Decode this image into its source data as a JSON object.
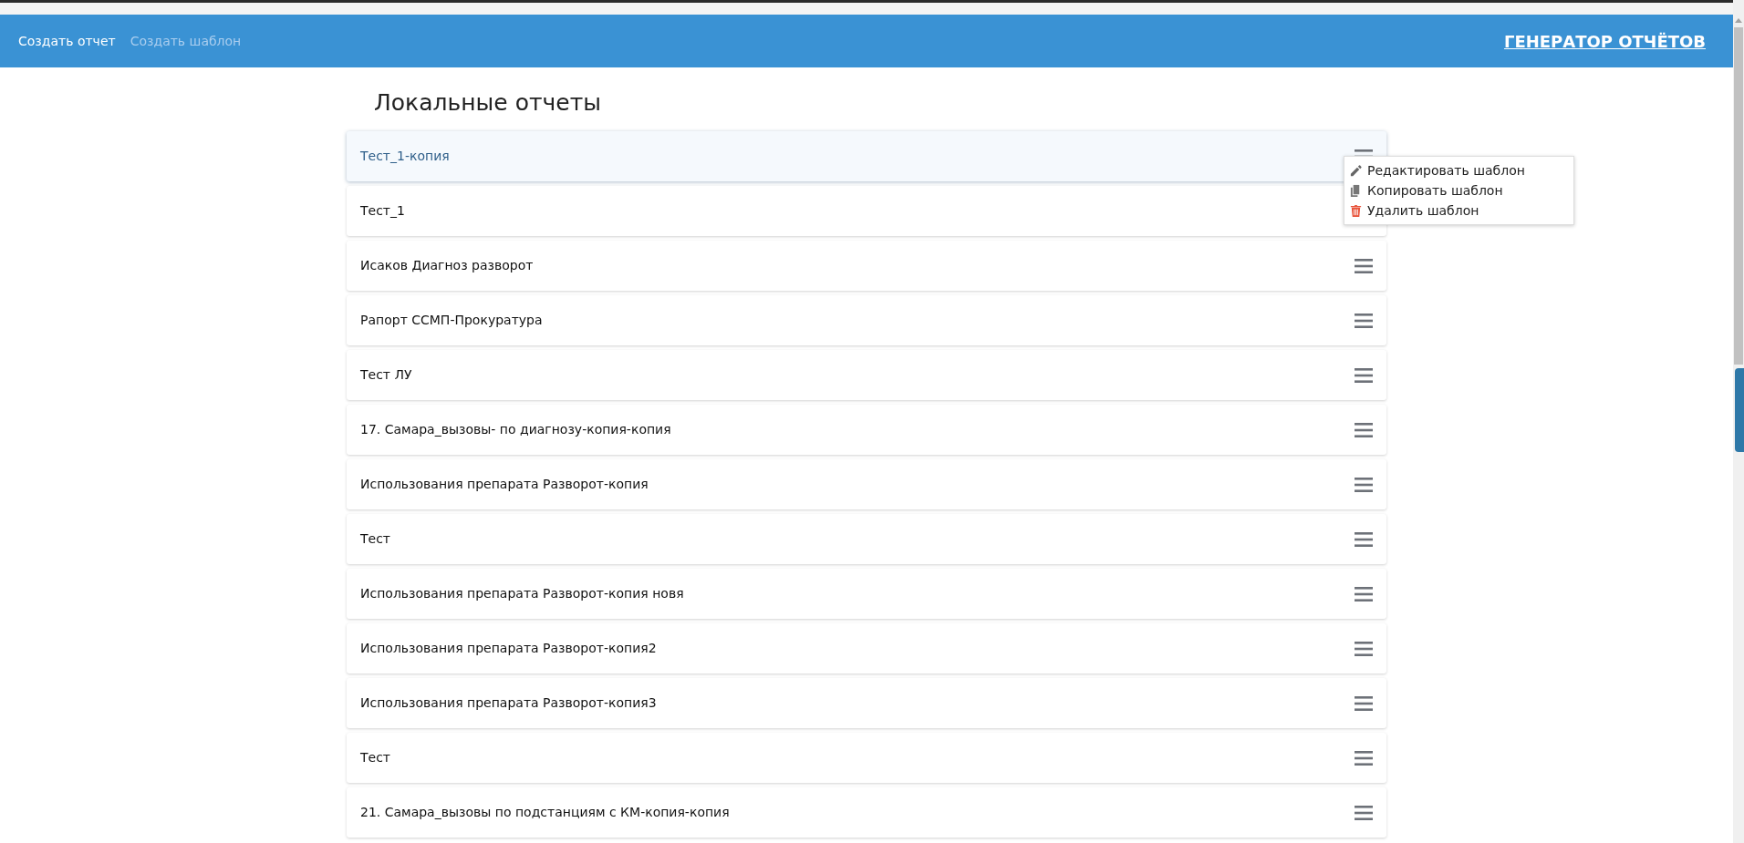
{
  "nav": {
    "links": [
      {
        "label": "Создать отчет",
        "selected": true
      },
      {
        "label": "Создать шаблон",
        "selected": false
      }
    ],
    "brand": "ГЕНЕРАТОР ОТЧЁТОВ"
  },
  "heading": "Локальные отчеты",
  "reports": [
    {
      "name": "Тест_1-копия",
      "selected": true
    },
    {
      "name": "Тест_1",
      "selected": false
    },
    {
      "name": "Исаков Диагноз разворот",
      "selected": false
    },
    {
      "name": "Рапорт ССМП-Прокуратура",
      "selected": false
    },
    {
      "name": "Тест ЛУ",
      "selected": false
    },
    {
      "name": "17. Самара_вызовы- по диагнозу-копия-копия",
      "selected": false
    },
    {
      "name": "Использования препарата Разворот-копия",
      "selected": false
    },
    {
      "name": "Тест",
      "selected": false
    },
    {
      "name": "Использования препарата Разворот-копия новя",
      "selected": false
    },
    {
      "name": "Использования препарата Разворот-копия2",
      "selected": false
    },
    {
      "name": "Использования препарата Разворот-копия3",
      "selected": false
    },
    {
      "name": "Тест",
      "selected": false
    },
    {
      "name": "21. Самара_вызовы по подстанциям с КМ-копия-копия",
      "selected": false
    }
  ],
  "context_menu": {
    "items": [
      {
        "kind": "edit",
        "label": "Редактировать шаблон"
      },
      {
        "kind": "copy",
        "label": "Копировать шаблон"
      },
      {
        "kind": "delete",
        "label": "Удалить шаблон"
      }
    ]
  }
}
